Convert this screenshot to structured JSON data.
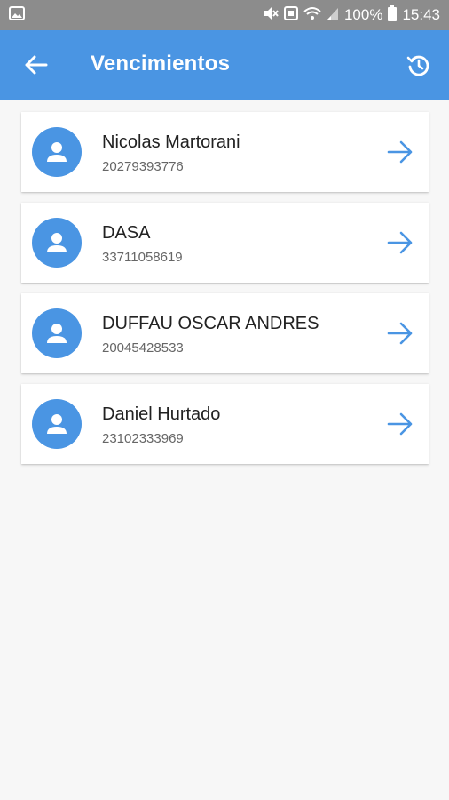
{
  "status_bar": {
    "battery_percent": "100%",
    "time": "15:43"
  },
  "app_bar": {
    "title": "Vencimientos",
    "back_icon": "arrow-back-icon",
    "refresh_icon": "history-refresh-icon"
  },
  "colors": {
    "primary": "#4a95e3",
    "status_bar": "#8c8c8c",
    "background": "#f7f7f7"
  },
  "contacts": [
    {
      "name": "Nicolas Martorani",
      "id": "20279393776"
    },
    {
      "name": "DASA",
      "id": "33711058619"
    },
    {
      "name": "DUFFAU OSCAR ANDRES",
      "id": "20045428533"
    },
    {
      "name": "Daniel Hurtado",
      "id": "23102333969"
    }
  ]
}
